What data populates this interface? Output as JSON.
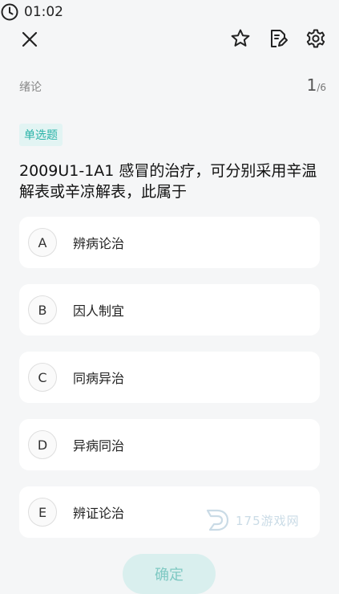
{
  "header": {
    "timer": "01:02"
  },
  "subheader": {
    "chapter": "绪论",
    "progress_current": "1",
    "progress_total": "/6"
  },
  "question": {
    "type": "单选题",
    "text": "2009U1-1A1 感冒的治疗，可分别采用辛温解表或辛凉解表，此属于"
  },
  "options": [
    {
      "letter": "A",
      "text": "辨病论治"
    },
    {
      "letter": "B",
      "text": "因人制宜"
    },
    {
      "letter": "C",
      "text": "同病异治"
    },
    {
      "letter": "D",
      "text": "异病同治"
    },
    {
      "letter": "E",
      "text": "辨证论治"
    }
  ],
  "actions": {
    "confirm": "确定"
  },
  "watermark": {
    "text": "175游戏网"
  },
  "colors": {
    "accent": "#2ab3a8",
    "tag_bg": "#e2f4f3",
    "confirm_bg": "#d9efee"
  },
  "icons": [
    "close-icon",
    "clock-icon",
    "star-icon",
    "note-edit-icon",
    "gear-icon"
  ]
}
